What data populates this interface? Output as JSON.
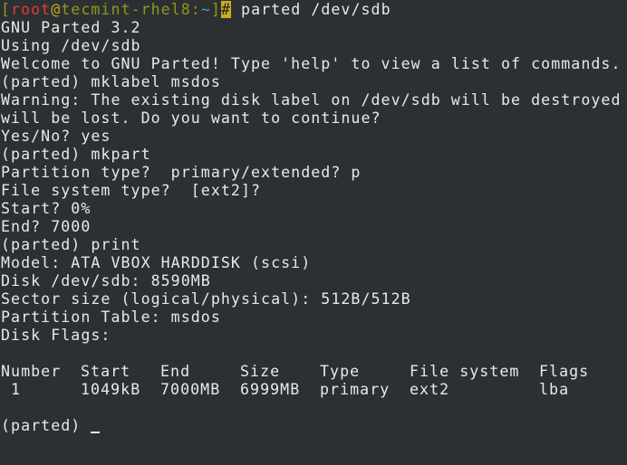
{
  "prompt": {
    "open_bracket": "[",
    "user": "root",
    "at": "@",
    "host": "tecmint-rhel8",
    "colon": ":",
    "cwd": "~",
    "close_bracket": "]",
    "symbol": "#",
    "command": " parted /dev/sdb"
  },
  "output_lines": [
    "GNU Parted 3.2",
    "Using /dev/sdb",
    "Welcome to GNU Parted! Type 'help' to view a list of commands.",
    "(parted) mklabel msdos",
    "Warning: The existing disk label on /dev/sdb will be destroyed",
    "will be lost. Do you want to continue?",
    "Yes/No? yes",
    "(parted) mkpart",
    "Partition type?  primary/extended? p",
    "File system type?  [ext2]?",
    "Start? 0%",
    "End? 7000",
    "(parted) print",
    "Model: ATA VBOX HARDDISK (scsi)",
    "Disk /dev/sdb: 8590MB",
    "Sector size (logical/physical): 512B/512B",
    "Partition Table: msdos",
    "Disk Flags:",
    ""
  ],
  "partition_table": {
    "headers": [
      "Number",
      "Start",
      "End",
      "Size",
      "Type",
      "File system",
      "Flags"
    ],
    "rows": [
      [
        " 1",
        "1049kB",
        "7000MB",
        "6999MB",
        "primary",
        "ext2",
        "lba"
      ]
    ]
  },
  "final_prompt": "(parted) ",
  "colors": {
    "background": "#2d3033",
    "foreground": "#e8e8e8",
    "prompt_user": "#e03a3a",
    "prompt_host": "#8a9a1a",
    "prompt_at": "#c8a820",
    "prompt_tilde": "#3aa8c8"
  }
}
